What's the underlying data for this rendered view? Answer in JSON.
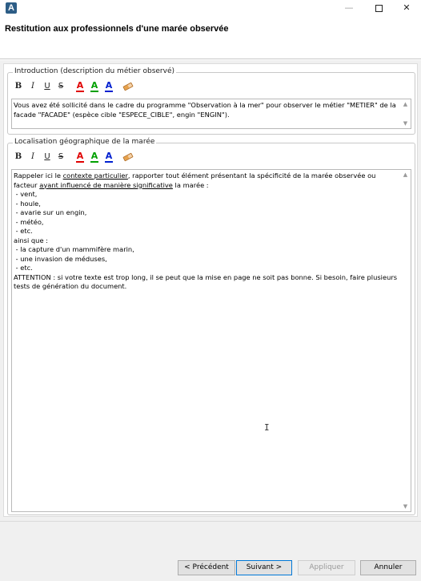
{
  "window": {
    "app_icon": "A",
    "minimize": "—",
    "close": "✕"
  },
  "header": {
    "title": "Restitution aux professionnels d'une marée observée"
  },
  "toolbar": {
    "bold": "B",
    "italic": "I",
    "underline": "U",
    "strike": "S",
    "color_red": "A",
    "color_green": "A",
    "color_blue": "A",
    "colors": {
      "red": "#e00000",
      "green": "#00a000",
      "blue": "#0020d0"
    }
  },
  "intro": {
    "label": "Introduction (description du métier observé)",
    "text": "Vous avez été sollicité dans le cadre du programme \"Observation à la mer\" pour observer le métier \"METIER\" de la facade \"FACADE\" (espèce cible \"ESPECE_CIBLE\", engin \"ENGIN\")."
  },
  "location": {
    "label": "Localisation géographique de la marée",
    "text_1": "Rappeler ici le ",
    "link_1": "contexte particulier",
    "text_2": ", rapporter tout élément présentant la spécificité de la marée observée ou facteur ",
    "link_2": "ayant influencé de manière significative",
    "text_3": " la marée :\n - vent,\n - houle,\n - avarie sur un engin,\n - météo,\n - etc.\nainsi que :\n - la capture d'un mammifère marin,\n - une invasion de méduses,\n - etc.\nATTENTION : si votre texte est trop long, il se peut que la mise en page ne soit pas bonne. Si besoin, faire plusieurs tests de génération du document."
  },
  "scrollbar": {
    "up": "▲",
    "down": "▼"
  },
  "cursor": "I",
  "footer": {
    "prev": "< Précédent",
    "next": "Suivant >",
    "apply": "Appliquer",
    "cancel": "Annuler"
  }
}
